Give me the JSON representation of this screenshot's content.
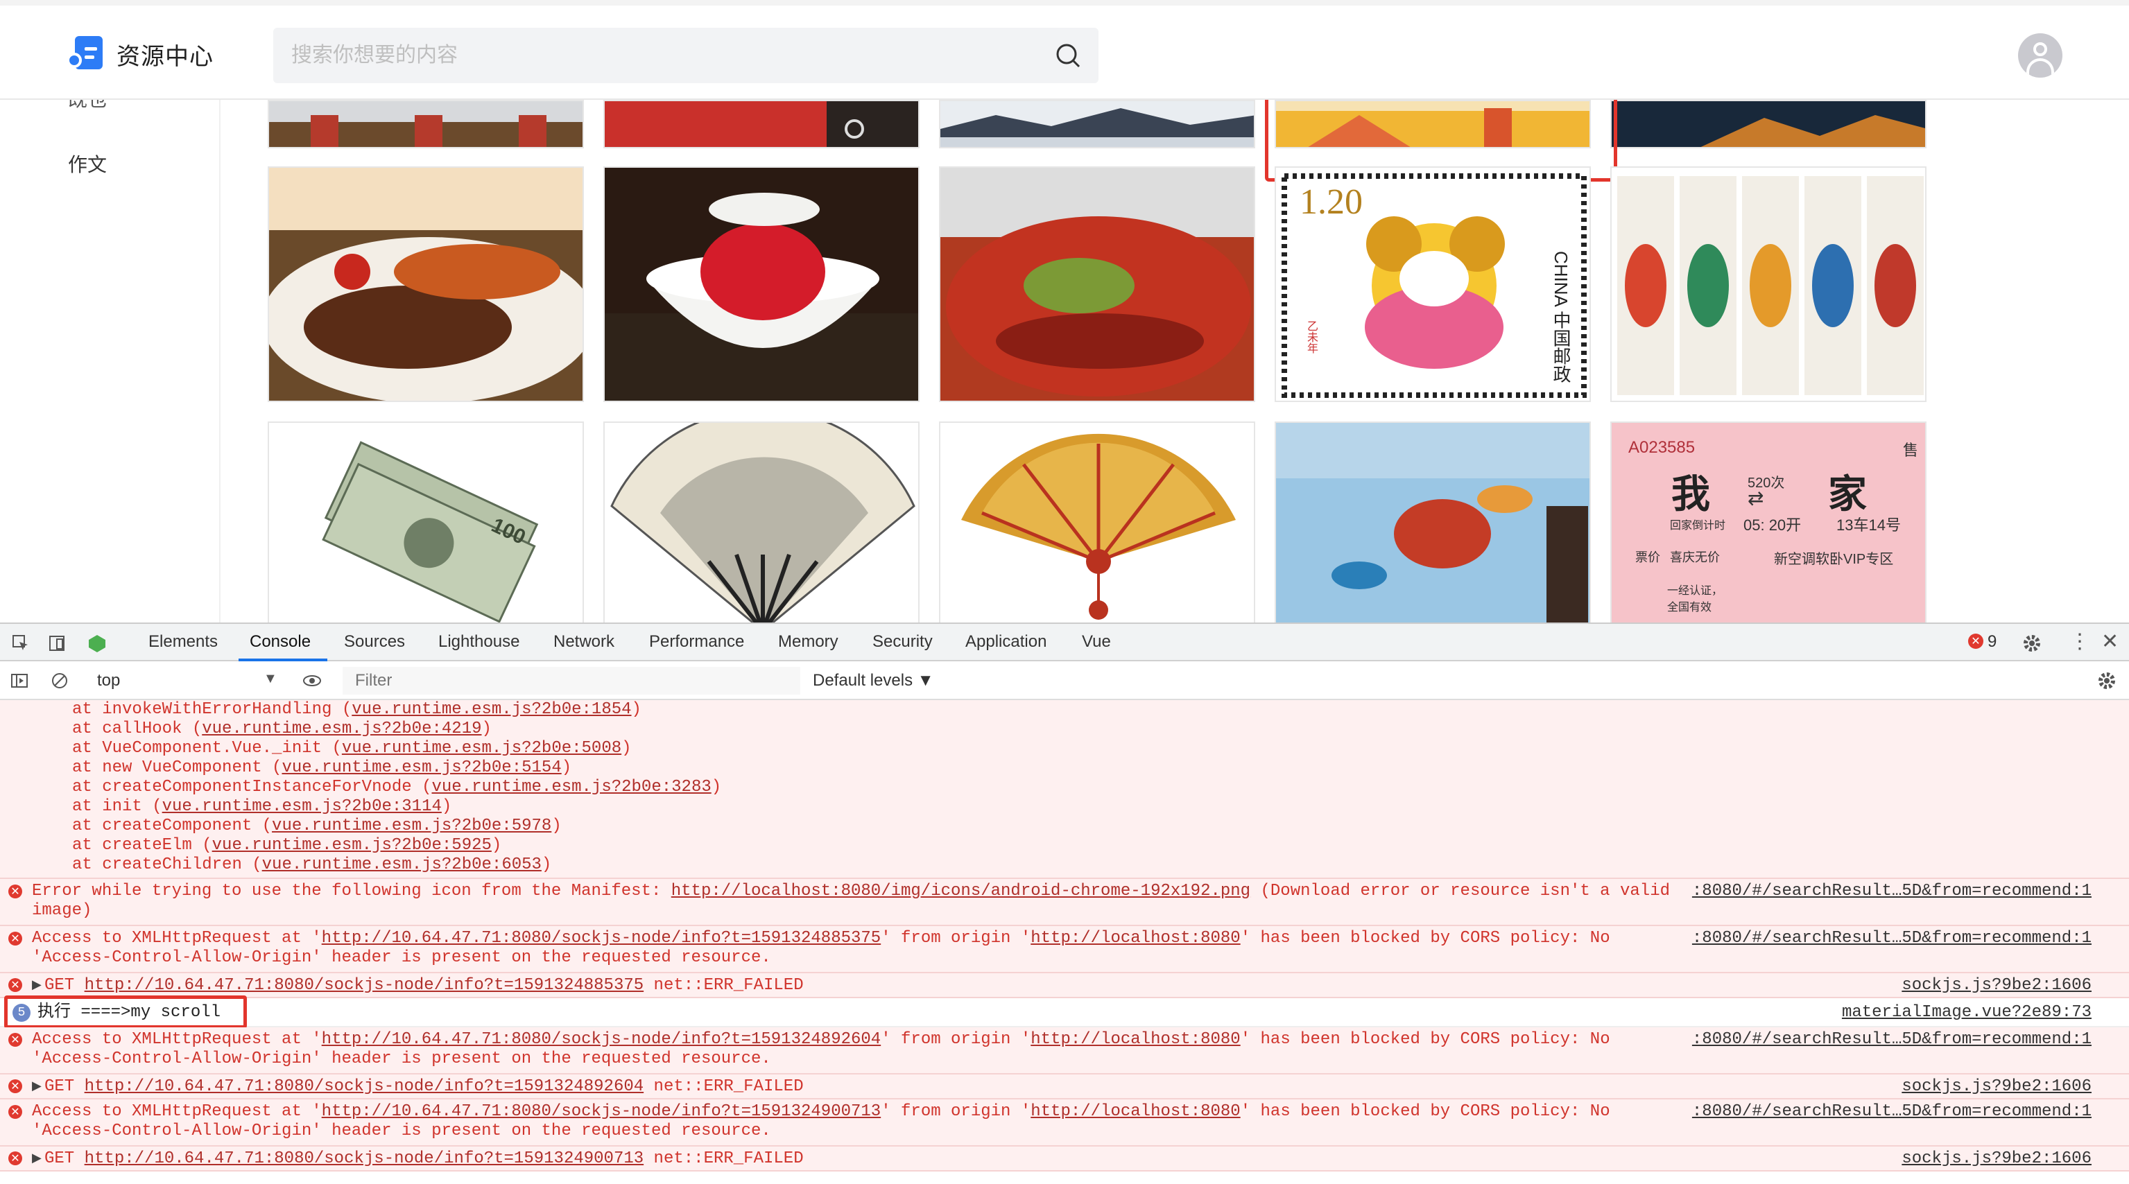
{
  "header": {
    "site_name": "资源中心",
    "search_placeholder": "搜索你想要的内容"
  },
  "sidebar": {
    "items": [
      "既也",
      "作文"
    ]
  },
  "devtools": {
    "tabs": [
      "Elements",
      "Console",
      "Sources",
      "Lighthouse",
      "Network",
      "Performance",
      "Memory",
      "Security",
      "Application",
      "Vue"
    ],
    "active_tab": "Console",
    "error_count": "9",
    "context": "top",
    "filter_placeholder": "Filter",
    "levels": "Default levels ▼"
  },
  "console": {
    "stack_lines": [
      {
        "text": "at invokeWithErrorHandling (",
        "link": "vue.runtime.esm.js?2b0e:1854"
      },
      {
        "text": "at callHook (",
        "link": "vue.runtime.esm.js?2b0e:4219"
      },
      {
        "text": "at VueComponent.Vue._init (",
        "link": "vue.runtime.esm.js?2b0e:5008"
      },
      {
        "text": "at new VueComponent (",
        "link": "vue.runtime.esm.js?2b0e:5154"
      },
      {
        "text": "at createComponentInstanceForVnode (",
        "link": "vue.runtime.esm.js?2b0e:3283"
      },
      {
        "text": "at init (",
        "link": "vue.runtime.esm.js?2b0e:3114"
      },
      {
        "text": "at createComponent (",
        "link": "vue.runtime.esm.js?2b0e:5978"
      },
      {
        "text": "at createElm (",
        "link": "vue.runtime.esm.js?2b0e:5925"
      },
      {
        "text": "at createChildren (",
        "link": "vue.runtime.esm.js?2b0e:6053"
      }
    ],
    "manifest_error": {
      "prefix": "Error while trying to use the following icon from the Manifest: ",
      "url": "http://localhost:8080/img/icons/android-chrome-192x192.png",
      "suffix": " (Download error or resource isn't a valid",
      "line2": "image)",
      "source": ":8080/#/searchResult…5D&from=recommend:1"
    },
    "cors_errors": [
      {
        "url": "http://10.64.47.71:8080/sockjs-node/info?t=1591324885375"
      },
      {
        "url": "http://10.64.47.71:8080/sockjs-node/info?t=1591324892604"
      },
      {
        "url": "http://10.64.47.71:8080/sockjs-node/info?t=1591324900713"
      }
    ],
    "cors_text": {
      "a": "Access to XMLHttpRequest at '",
      "b": "' from origin '",
      "origin": "http://localhost:8080",
      "c": "' has been blocked by CORS policy: No",
      "line2": "'Access-Control-Allow-Origin' header is present on the requested resource.",
      "source": ":8080/#/searchResult…5D&from=recommend:1"
    },
    "get_errors": [
      {
        "url": "http://10.64.47.71:8080/sockjs-node/info?t=1591324885375"
      },
      {
        "url": "http://10.64.47.71:8080/sockjs-node/info?t=1591324892604"
      },
      {
        "url": "http://10.64.47.71:8080/sockjs-node/info?t=1591324900713"
      }
    ],
    "get_text": {
      "method": "GET",
      "status": " net::ERR_FAILED",
      "source": "sockjs.js?9be2:1606"
    },
    "log": {
      "count": "5",
      "text": "执行 ====>my scroll",
      "source": "materialImage.vue?2e89:73"
    }
  },
  "images": {
    "stamp_value": "1.20",
    "stamp_country": "CHINA 中国邮政",
    "stamp_year": "乙未年",
    "ticket_no": "A023585",
    "ticket_sale": "售",
    "ticket_from": "我",
    "ticket_to": "家",
    "ticket_train": "520次",
    "ticket_time_label": "回家倒计时",
    "ticket_time": "05: 20开",
    "ticket_seat": "13车14号",
    "ticket_price_label": "票价",
    "ticket_price": "喜庆无价",
    "ticket_class": "新空调软卧VIP专区",
    "ticket_note1": "一经认证，",
    "ticket_note2": "全国有效",
    "banknote": "100"
  }
}
